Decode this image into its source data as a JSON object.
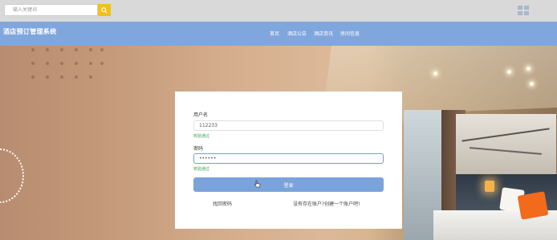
{
  "topbar": {
    "search_placeholder": "输入关键词",
    "search_icon": "search-icon",
    "grid_icon": "grid-icon"
  },
  "nav": {
    "site_title": "酒店预订管理系统",
    "items": [
      "首页",
      "酒店公告",
      "酒店资讯",
      "房间信息"
    ]
  },
  "login": {
    "username_label": "用户名",
    "username_value": "112233",
    "username_status": "校验通过",
    "password_label": "密码",
    "password_value": "••••••",
    "password_status": "校验通过",
    "submit_label": "登录",
    "forgot_link": "找回密码",
    "register_link": "没有存在账户?创建一个账户吧!"
  },
  "colors": {
    "nav_bg": "#80a7dd",
    "button_bg": "#7aa3dc",
    "search_button": "#f2c118",
    "success_text": "#3ca64c"
  }
}
